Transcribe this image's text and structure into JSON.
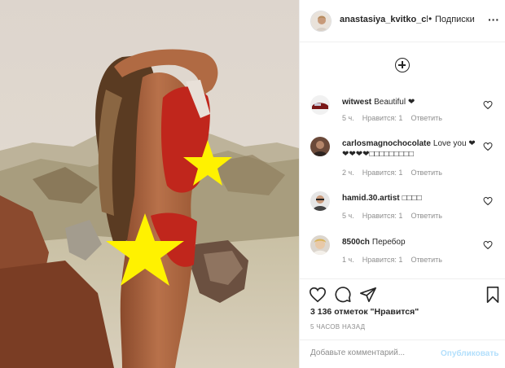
{
  "header": {
    "username": "anastasiya_kvitko_clul",
    "separator": "•",
    "follow_label": "Подписки",
    "more_icon": "more-horizontal-icon"
  },
  "comments_panel": {
    "load_more_icon": "plus-circle-icon"
  },
  "comments": [
    {
      "username": "witwest",
      "text": "Beautiful ❤",
      "time": "5 ч.",
      "likes": "Нравится: 1",
      "reply": "Ответить"
    },
    {
      "username": "carlosmagnochocolate",
      "text": "Love you ❤❤❤❤❤□□□□□□□□□",
      "time": "2 ч.",
      "likes": "Нравится: 1",
      "reply": "Ответить"
    },
    {
      "username": "hamid.30.artist",
      "text": "□□□□",
      "time": "5 ч.",
      "likes": "Нравится: 1",
      "reply": "Ответить"
    },
    {
      "username": "8500ch",
      "text": "Перебор",
      "time": "1 ч.",
      "likes": "Нравится: 1",
      "reply": "Ответить"
    }
  ],
  "post": {
    "likes_text": "3 136 отметок \"Нравится\"",
    "time_ago": "5 ЧАСОВ НАЗАД"
  },
  "comment_box": {
    "placeholder": "Добавьте комментарий...",
    "post_label": "Опубликовать"
  },
  "colors": {
    "link_disabled": "#b2dffc",
    "meta_gray": "#8e8e8e",
    "censor_star": "#fff200"
  }
}
